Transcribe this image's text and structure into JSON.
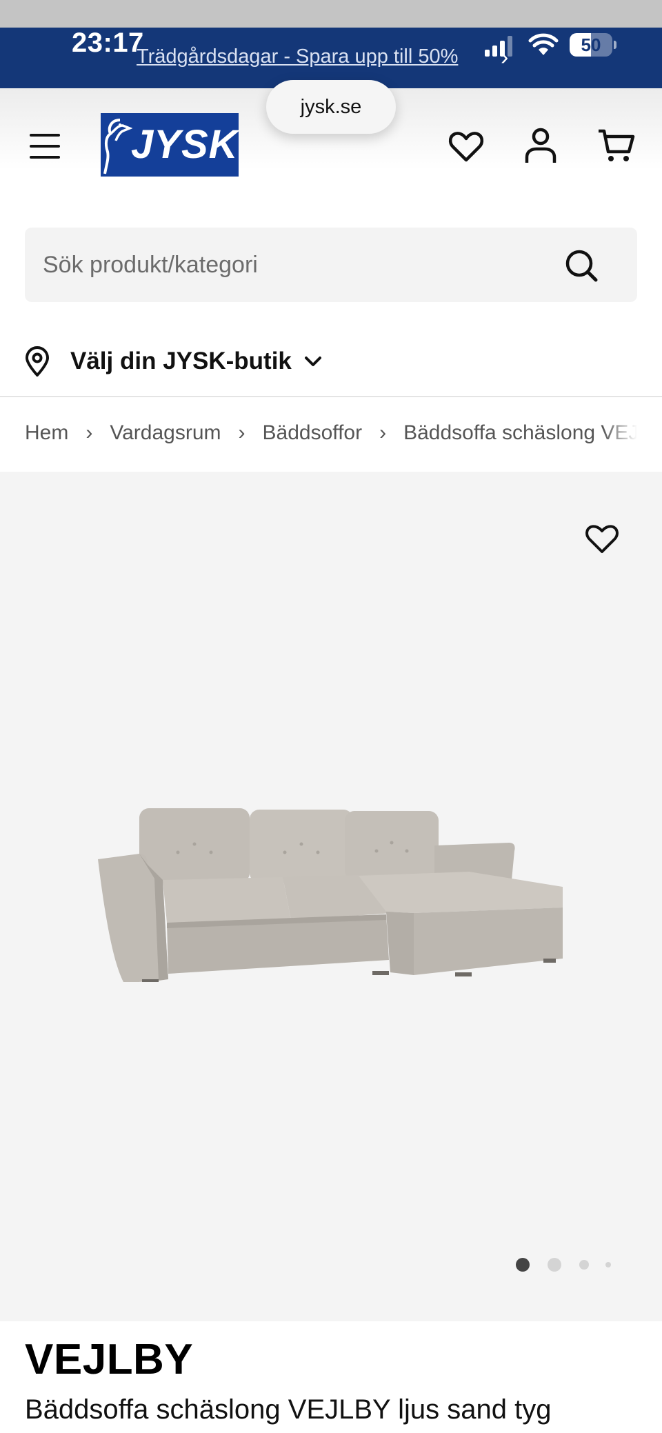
{
  "status_bar": {
    "time": "23:17",
    "battery_level": "50",
    "battery_fraction": 0.5
  },
  "promo": {
    "text": "Trädgårdsdagar - Spara upp till 50%",
    "chevron": "›"
  },
  "browser": {
    "url": "jysk.se"
  },
  "header": {
    "logo_text": "JYSK",
    "icons": [
      "menu-icon",
      "heart-icon",
      "user-icon",
      "cart-icon"
    ],
    "brand_color": "#143f99",
    "banner_color": "#143778"
  },
  "search": {
    "placeholder": "Sök produkt/kategori",
    "value": ""
  },
  "store_picker": {
    "label": "Välj din JYSK-butik"
  },
  "breadcrumb": {
    "separator": "›",
    "items": [
      "Hem",
      "Vardagsrum",
      "Bäddsoffor",
      "Bäddsoffa schäslong VEJLBY"
    ]
  },
  "gallery": {
    "image_count": 4,
    "active_index": 0
  },
  "product": {
    "name": "VEJLBY",
    "subtitle": "Bäddsoffa schäslong VEJLBY ljus sand tyg"
  }
}
